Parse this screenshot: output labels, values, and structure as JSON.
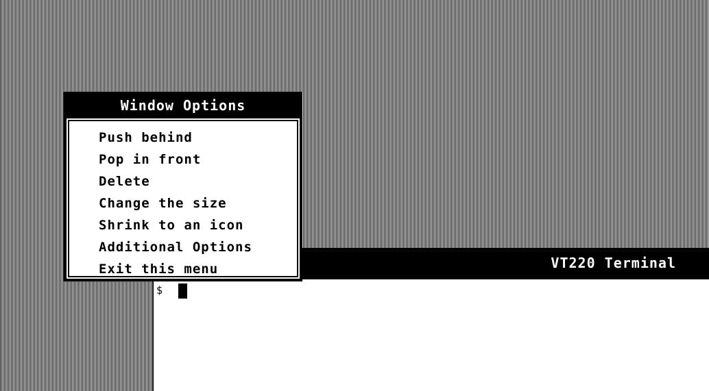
{
  "terminal": {
    "title": "VT220 Terminal",
    "prompt": "$"
  },
  "menu": {
    "title": "Window Options",
    "items": [
      {
        "label": "Push behind"
      },
      {
        "label": "Pop in front"
      },
      {
        "label": "Delete"
      },
      {
        "label": "Change the size"
      },
      {
        "label": "Shrink to an icon"
      },
      {
        "label": "Additional Options"
      },
      {
        "label": "Exit this menu"
      }
    ]
  }
}
